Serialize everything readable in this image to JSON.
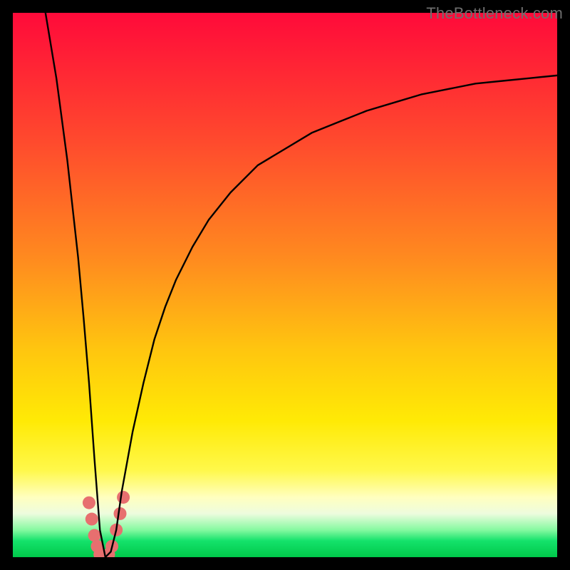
{
  "attribution": "TheBottleneck.com",
  "chart_data": {
    "type": "line",
    "title": "",
    "xlabel": "",
    "ylabel": "",
    "xlim": [
      0,
      100
    ],
    "ylim": [
      0,
      100
    ],
    "series": [
      {
        "name": "bottleneck-curve",
        "x": [
          6,
          8,
          10,
          12,
          13,
          14,
          15,
          16,
          17,
          18,
          19,
          20,
          22,
          24,
          26,
          28,
          30,
          33,
          36,
          40,
          45,
          50,
          55,
          60,
          65,
          70,
          75,
          80,
          85,
          90,
          95,
          100
        ],
        "y": [
          100,
          88,
          73,
          55,
          44,
          32,
          18,
          5,
          0,
          1,
          5,
          12,
          23,
          32,
          40,
          46,
          51,
          57,
          62,
          67,
          72,
          75,
          78,
          80,
          82,
          83.5,
          85,
          86,
          87,
          87.5,
          88,
          88.5
        ]
      }
    ],
    "markers": {
      "name": "highlight-band",
      "shape": "rounded-dot",
      "color": "#e76f6f",
      "points": [
        {
          "x": 14.0,
          "y": 10
        },
        {
          "x": 14.5,
          "y": 7
        },
        {
          "x": 15.0,
          "y": 4
        },
        {
          "x": 15.5,
          "y": 2
        },
        {
          "x": 16.0,
          "y": 0.5
        },
        {
          "x": 16.8,
          "y": 0
        },
        {
          "x": 17.6,
          "y": 0.5
        },
        {
          "x": 18.2,
          "y": 2
        },
        {
          "x": 19.0,
          "y": 5
        },
        {
          "x": 19.7,
          "y": 8
        },
        {
          "x": 20.3,
          "y": 11
        }
      ]
    },
    "background_gradient": {
      "top": "#ff0a3a",
      "mid_high": "#ffc60f",
      "mid_low": "#fff84a",
      "bottom": "#00c84a"
    }
  }
}
